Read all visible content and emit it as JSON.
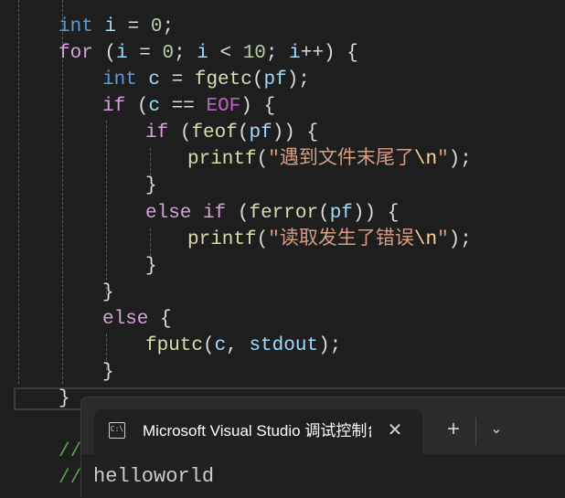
{
  "code": {
    "line_init": {
      "type": "int",
      "name": "i",
      "op": " = ",
      "value": "0",
      "end": ";"
    },
    "line_for": {
      "kw": "for",
      "open": " (",
      "var1": "i",
      "eq": " = ",
      "zero": "0",
      "semi1": "; ",
      "var2": "i",
      "lt": " < ",
      "ten": "10",
      "semi2": "; ",
      "var3": "i",
      "inc": "++",
      "close": ") ",
      "brace": "{"
    },
    "line_getc": {
      "type": "int",
      "name": "c",
      "eq": " = ",
      "fn": "fgetc",
      "open": "(",
      "arg": "pf",
      "close": ");"
    },
    "line_if_eof": {
      "kw": "if",
      "open": " (",
      "var": "c",
      "op": " == ",
      "macro": "EOF",
      "close": ") ",
      "brace": "{"
    },
    "line_if_feof": {
      "kw": "if",
      "open": " (",
      "fn": "feof",
      "p1": "(",
      "arg": "pf",
      "p2": ")) ",
      "brace": "{"
    },
    "line_printf1": {
      "fn": "printf",
      "open": "(",
      "str": "\"遇到文件末尾了",
      "esc": "\\n",
      "strend": "\"",
      "close": ");"
    },
    "line_close1": "}",
    "line_else_if": {
      "kw1": "else",
      "kw2": "if",
      "open": " (",
      "fn": "ferror",
      "p1": "(",
      "arg": "pf",
      "p2": ")) ",
      "brace": "{"
    },
    "line_printf2": {
      "fn": "printf",
      "open": "(",
      "str": "\"读取发生了错误",
      "esc": "\\n",
      "strend": "\"",
      "close": ");"
    },
    "line_close2": "}",
    "line_close3": "}",
    "line_else": {
      "kw": "else",
      "brace": " {"
    },
    "line_fputc": {
      "fn": "fputc",
      "open": "(",
      "arg1": "c",
      "comma": ", ",
      "arg2": "stdout",
      "close": ");"
    },
    "line_close4": "}",
    "line_close5": "}",
    "comment1": "//",
    "comment2": "//"
  },
  "terminal": {
    "tab_icon": "C:\\",
    "tab_title": "Microsoft Visual Studio 调试控制台",
    "close_icon": "✕",
    "new_tab_icon": "+",
    "dropdown_icon": "⌄",
    "output": "helloworld"
  },
  "colors": {
    "background": "#1e1e1e",
    "keyword": "#569cd6",
    "control": "#d8a0df",
    "variable": "#9cdcfe",
    "function": "#dcdcaa",
    "number": "#b5cea8",
    "string": "#d69d85",
    "macro": "#bd63c5"
  }
}
